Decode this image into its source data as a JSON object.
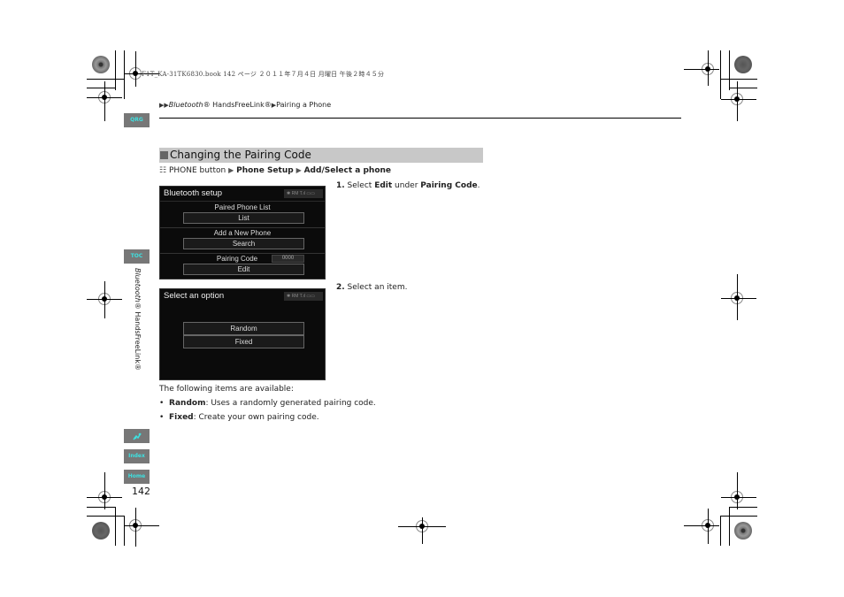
{
  "print_meta": "F1T_KA-31TK6830.book  142 ページ  ２０１１年７月４日  月曜日  午後２時４５分",
  "breadcrumb": {
    "items": [
      "Bluetooth",
      "® HandsFreeLink®",
      "Pairing a Phone"
    ]
  },
  "side_tabs": {
    "qrg": "QRG",
    "toc": "TOC",
    "index": "Index",
    "home": "Home",
    "voice_icon": "voice-command-icon"
  },
  "side_title": {
    "italic": "Bluetooth",
    "rest": "® HandsFreeLink®"
  },
  "page_number": "142",
  "section": {
    "title": "Changing the Pairing Code",
    "path": {
      "start": "PHONE button",
      "step1": "Phone Setup",
      "step2": "Add/Select a phone"
    }
  },
  "screen1": {
    "title": "Bluetooth setup",
    "status": "✱ RM  T.ıl ▭▭",
    "paired_label": "Paired Phone List",
    "list_button": "List",
    "add_label": "Add a New Phone",
    "search_button": "Search",
    "pairing_label": "Pairing Code",
    "pairing_value": "0000",
    "edit_button": "Edit"
  },
  "screen2": {
    "title": "Select an option",
    "status": "✱ RM  T.ıl ▭▭",
    "random_button": "Random",
    "fixed_button": "Fixed"
  },
  "steps": [
    {
      "num": "1.",
      "pre": " Select ",
      "b1": "Edit",
      "mid": " under ",
      "b2": "Pairing Code",
      "post": "."
    },
    {
      "num": "2.",
      "text": " Select an item."
    }
  ],
  "items_intro": "The following items are available:",
  "items": [
    {
      "name": "Random",
      "desc": ": Uses a randomly generated pairing code."
    },
    {
      "name": "Fixed",
      "desc": ": Create your own pairing code."
    }
  ]
}
